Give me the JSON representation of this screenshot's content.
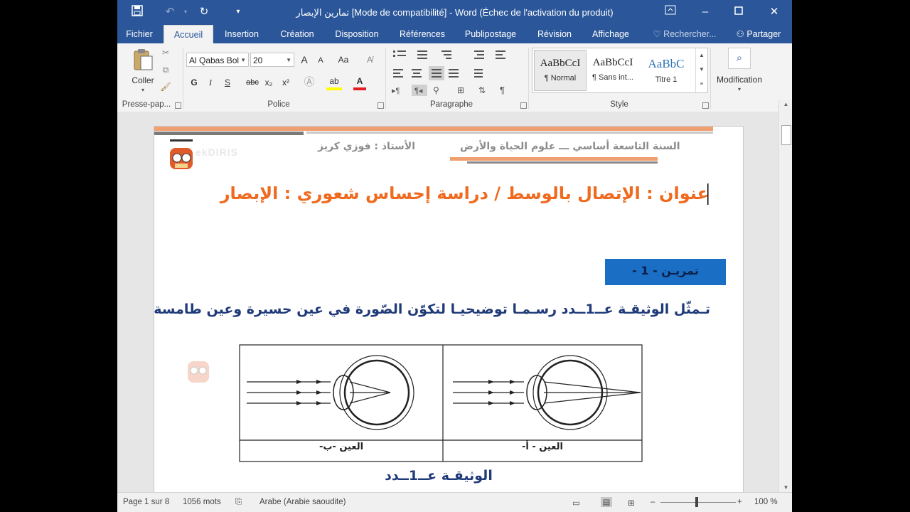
{
  "window": {
    "title": "تمارين الإبصار [Mode de compatibilité] - Word (Échec de l'activation du produit)"
  },
  "tabs": [
    "Fichier",
    "Accueil",
    "Insertion",
    "Création",
    "Disposition",
    "Références",
    "Publipostage",
    "Révision",
    "Affichage"
  ],
  "search": {
    "label": "Rechercher..."
  },
  "share": {
    "label": "Partager"
  },
  "ribbon": {
    "clipboard": {
      "paste_label": "Coller",
      "group_label": "Presse-pap..."
    },
    "font": {
      "name": "Al Qabas Bol",
      "size": "20",
      "group_label": "Police",
      "bold": "G",
      "italic": "I",
      "underline": "S",
      "strike": "abc",
      "sub": "x₂",
      "sup": "x²",
      "case": "Aa",
      "grow": "A",
      "shrink": "A",
      "highlight": "ab",
      "color": "A"
    },
    "paragraph": {
      "group_label": "Paragraphe",
      "pilcrow": "¶"
    },
    "styles": {
      "group_label": "Style",
      "items": [
        {
          "preview": "AaBbCcI",
          "name": "¶ Normal"
        },
        {
          "preview": "AaBbCcI",
          "name": "¶ Sans int..."
        },
        {
          "preview": "AaBbC",
          "name": "Titre 1"
        }
      ]
    },
    "editing": {
      "label": "Modification"
    }
  },
  "document": {
    "header_right": "السنة التاسعة أساسي ـــ علوم الحياة والأرض",
    "header_left": "الأستاذ : فوزي كريز",
    "watermark": "ekDIRIS",
    "title": "عنوان : الإتصال بالوسط / دراسة إحساس شعوري : الإبصار",
    "exercise_box": "تمريـن - 1 -",
    "instruction": "تـمثّل الوثيقـة عــ1ــدد رسـمـا توضيحيـا لتكوّن الصّورة في عين حسيرة وعين طامسة",
    "eye_a_label": "العين - أ-",
    "eye_b_label": "العين -ب-",
    "caption": "الوثيقـة عــ1ــدد"
  },
  "status": {
    "page": "Page 1 sur 8",
    "words": "1056 mots",
    "language": "Arabe (Arabie saoudite)",
    "zoom": "100 %"
  },
  "colors": {
    "accent": "#2b579a",
    "title_orange": "#ef6a1e",
    "exercise_box": "#1a6fc4",
    "instruction_blue": "#1f3a78",
    "header_grey": "#8c8c8c"
  }
}
